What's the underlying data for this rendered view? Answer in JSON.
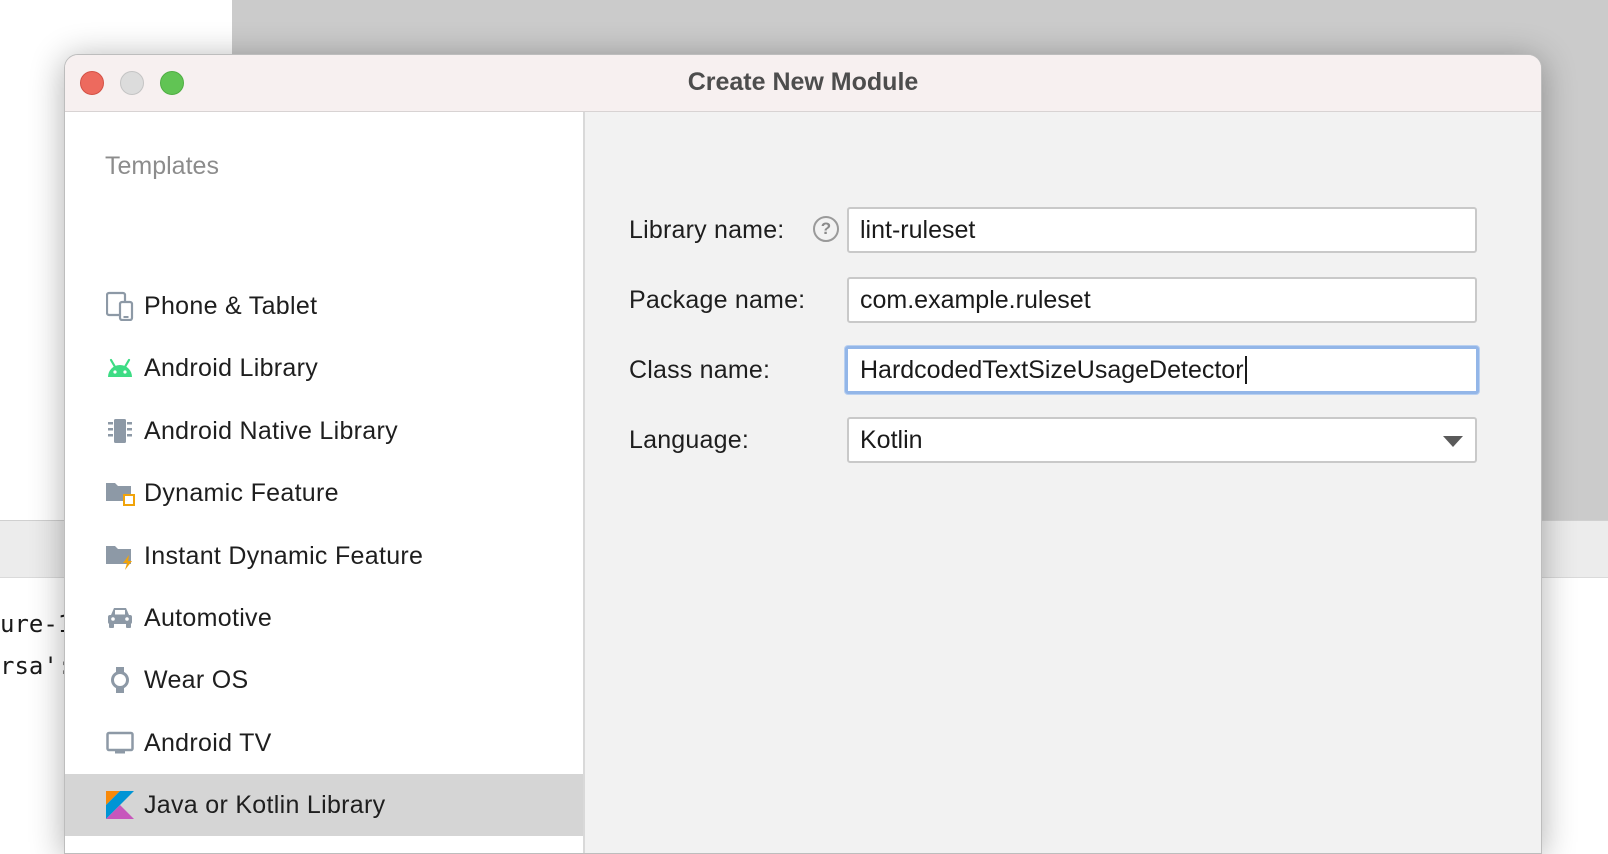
{
  "window": {
    "title": "Create New Module"
  },
  "background": {
    "code_lines": [
      "ure-1",
      "rsa':"
    ]
  },
  "sidebar": {
    "header": "Templates",
    "items": [
      {
        "label": "Phone & Tablet",
        "icon": "phone-tablet-icon"
      },
      {
        "label": "Android Library",
        "icon": "android-icon"
      },
      {
        "label": "Android Native Library",
        "icon": "native-library-icon"
      },
      {
        "label": "Dynamic Feature",
        "icon": "dynamic-feature-folder-icon"
      },
      {
        "label": "Instant Dynamic Feature",
        "icon": "instant-feature-folder-icon"
      },
      {
        "label": "Automotive",
        "icon": "car-icon"
      },
      {
        "label": "Wear OS",
        "icon": "watch-icon"
      },
      {
        "label": "Android TV",
        "icon": "tv-icon"
      },
      {
        "label": "Java or Kotlin Library",
        "icon": "kotlin-icon",
        "selected": true
      }
    ]
  },
  "form": {
    "library_name": {
      "label": "Library name:",
      "value": "lint-ruleset"
    },
    "package_name": {
      "label": "Package name:",
      "value": "com.example.ruleset"
    },
    "class_name": {
      "label": "Class name:",
      "value": "HardcodedTextSizeUsageDetector"
    },
    "language": {
      "label": "Language:",
      "value": "Kotlin"
    },
    "help_glyph": "?"
  },
  "colors": {
    "accent_focus": "#93b6e8",
    "selected_item": "#d5d5d5",
    "android_green": "#3ddc84",
    "kotlin_orange": "#f88909",
    "kotlin_blue": "#0095d5"
  }
}
